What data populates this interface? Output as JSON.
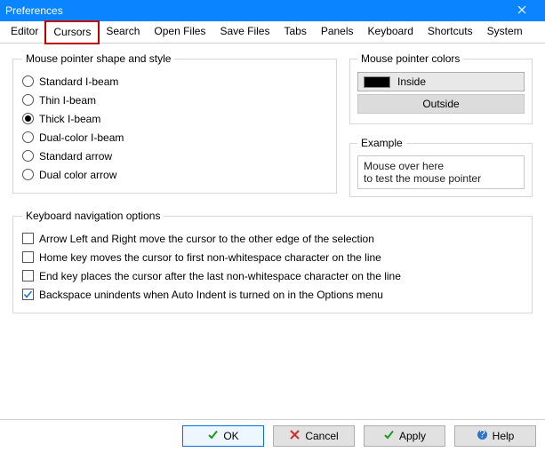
{
  "window": {
    "title": "Preferences"
  },
  "tabs": [
    {
      "label": "Editor"
    },
    {
      "label": "Cursors"
    },
    {
      "label": "Search"
    },
    {
      "label": "Open Files"
    },
    {
      "label": "Save Files"
    },
    {
      "label": "Tabs"
    },
    {
      "label": "Panels"
    },
    {
      "label": "Keyboard"
    },
    {
      "label": "Shortcuts"
    },
    {
      "label": "System"
    }
  ],
  "active_tab": "Cursors",
  "shape_group": {
    "legend": "Mouse pointer shape and style",
    "options": [
      {
        "label": "Standard I-beam",
        "checked": false
      },
      {
        "label": "Thin I-beam",
        "checked": false
      },
      {
        "label": "Thick I-beam",
        "checked": true
      },
      {
        "label": "Dual-color I-beam",
        "checked": false
      },
      {
        "label": "Standard arrow",
        "checked": false
      },
      {
        "label": "Dual color arrow",
        "checked": false
      }
    ]
  },
  "colors_group": {
    "legend": "Mouse pointer colors",
    "inside": {
      "label": "Inside",
      "swatch": "#000000"
    },
    "outside": {
      "label": "Outside"
    }
  },
  "example_group": {
    "legend": "Example",
    "line1": "Mouse over here",
    "line2": "to test the mouse pointer"
  },
  "nav_group": {
    "legend": "Keyboard navigation options",
    "items": [
      {
        "label": "Arrow Left and Right move the cursor to the other edge of the selection",
        "checked": false
      },
      {
        "label": "Home key moves the cursor to first non-whitespace character on the line",
        "checked": false
      },
      {
        "label": "End key places the cursor after the last non-whitespace character on the line",
        "checked": false
      },
      {
        "label": "Backspace unindents when Auto Indent is turned on in the Options menu",
        "checked": true
      }
    ]
  },
  "buttons": {
    "ok": "OK",
    "cancel": "Cancel",
    "apply": "Apply",
    "help": "Help"
  }
}
